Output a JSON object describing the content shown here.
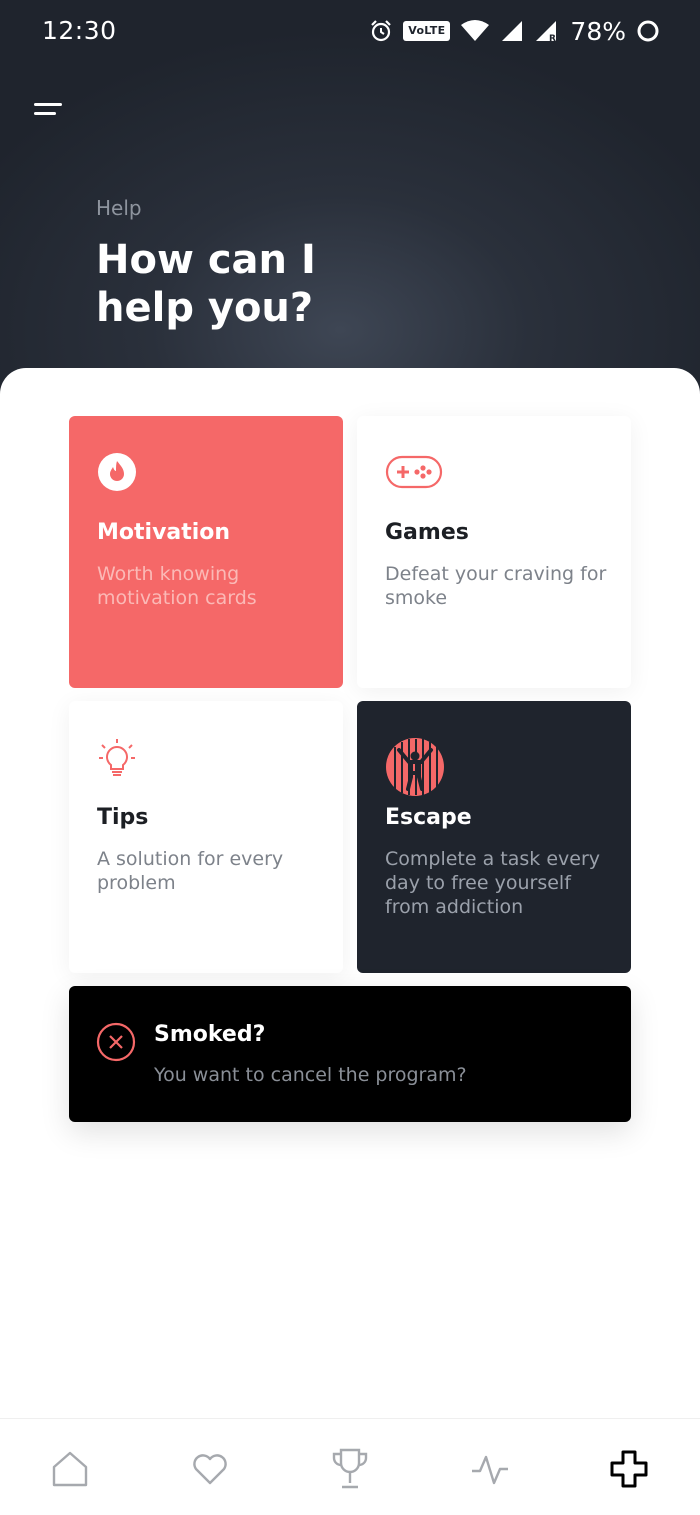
{
  "status_bar": {
    "time": "12:30",
    "network_badge": "VoLTE",
    "battery_percent": "78%"
  },
  "header": {
    "section_label": "Help",
    "title": "How can I help you?"
  },
  "cards": [
    {
      "title": "Motivation",
      "description": "Worth knowing motivation cards",
      "icon": "flame-icon",
      "color": "#f56868"
    },
    {
      "title": "Games",
      "description": "Defeat your craving for smoke",
      "icon": "gamepad-icon",
      "color": "#ffffff"
    },
    {
      "title": "Tips",
      "description": "A solution for every problem",
      "icon": "lightbulb-icon",
      "color": "#ffffff"
    },
    {
      "title": "Escape",
      "description": "Complete a task every day to free yourself from addiction",
      "icon": "prison-escape-icon",
      "color": "#1f242d"
    }
  ],
  "smoked": {
    "title": "Smoked?",
    "description": "You want to cancel the program?",
    "icon": "close-circle-icon"
  },
  "bottom_nav": {
    "items": [
      {
        "icon": "home-icon"
      },
      {
        "icon": "heart-icon"
      },
      {
        "icon": "trophy-icon"
      },
      {
        "icon": "activity-icon"
      },
      {
        "icon": "plus-cross-icon",
        "active": true
      }
    ]
  },
  "colors": {
    "accent": "#f56868",
    "dark": "#1f242d"
  }
}
